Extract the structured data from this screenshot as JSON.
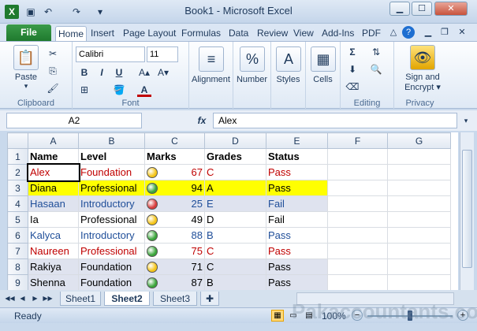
{
  "window": {
    "title": "Book1  -  Microsoft Excel"
  },
  "quick_access": {
    "save_icon": "save-icon",
    "undo_icon": "undo-icon",
    "redo_icon": "redo-icon",
    "customize_icon": "chevron-down-icon"
  },
  "window_controls": {
    "minimize": "▁",
    "maximize": "☐",
    "close": "✕"
  },
  "tabs": [
    "File",
    "Home",
    "Insert",
    "Page Layout",
    "Formulas",
    "Data",
    "Review",
    "View",
    "Add-Ins",
    "PDF"
  ],
  "active_tab": "Home",
  "ribbon": {
    "clipboard": {
      "label": "Clipboard",
      "paste": "Paste"
    },
    "font": {
      "label": "Font",
      "font_name": "Calibri",
      "font_size": "11",
      "bold": "B",
      "italic": "I",
      "underline": "U",
      "font_color_glyph": "A"
    },
    "alignment": {
      "label": "Alignment"
    },
    "number": {
      "label": "Number",
      "glyph": "%"
    },
    "styles": {
      "label": "Styles"
    },
    "cells": {
      "label": "Cells"
    },
    "editing": {
      "label": "Editing",
      "sum_glyph": "Σ"
    },
    "privacy": {
      "label": "Privacy",
      "sign_encrypt": "Sign and",
      "sign_encrypt2": "Encrypt ▾"
    }
  },
  "formula_bar": {
    "name_box": "A2",
    "fx": "fx",
    "value": "Alex"
  },
  "columns": [
    "",
    "A",
    "B",
    "C",
    "D",
    "E",
    "F",
    "G"
  ],
  "rows": [
    {
      "n": "1",
      "a": "Name",
      "b": "Level",
      "c": "Marks",
      "d": "Grades",
      "e": "Status",
      "bold": true
    },
    {
      "n": "2",
      "a": "Alex",
      "b": "Foundation",
      "c": "67",
      "d": "C",
      "e": "Pass",
      "color": "#c00000",
      "icon": "#f5c518"
    },
    {
      "n": "3",
      "a": "Diana",
      "b": "Professional",
      "c": "94",
      "d": "A",
      "e": "Pass",
      "color": "#000000",
      "icon": "#3aa53a",
      "fill": "#ffff00"
    },
    {
      "n": "4",
      "a": "Hasaan",
      "b": "Introductory",
      "c": "25",
      "d": "E",
      "e": "Fail",
      "color": "#1f4e99",
      "icon": "#d83b3b",
      "fill": "#dfe3ef"
    },
    {
      "n": "5",
      "a": "Ia",
      "b": "Professional",
      "c": "49",
      "d": "D",
      "e": "Fail",
      "color": "#000000",
      "icon": "#f5c518"
    },
    {
      "n": "6",
      "a": "Kalyca",
      "b": "Introductory",
      "c": "88",
      "d": "B",
      "e": "Pass",
      "color": "#1f4e99",
      "icon": "#3aa53a"
    },
    {
      "n": "7",
      "a": "Naureen",
      "b": "Professional",
      "c": "75",
      "d": "C",
      "e": "Pass",
      "color": "#c00000",
      "icon": "#3aa53a"
    },
    {
      "n": "8",
      "a": "Rakiya",
      "b": "Foundation",
      "c": "71",
      "d": "C",
      "e": "Pass",
      "color": "#000000",
      "icon": "#f5c518",
      "fill": "#dfe3ef"
    },
    {
      "n": "9",
      "a": "Shenna",
      "b": "Foundation",
      "c": "87",
      "d": "B",
      "e": "Pass",
      "color": "#000000",
      "icon": "#3aa53a",
      "fill": "#dfe3ef"
    }
  ],
  "sheets": [
    "Sheet1",
    "Sheet2",
    "Sheet3"
  ],
  "active_sheet": "Sheet2",
  "status": {
    "ready": "Ready",
    "zoom": "100%"
  },
  "watermark": "Pakaccountants.com"
}
